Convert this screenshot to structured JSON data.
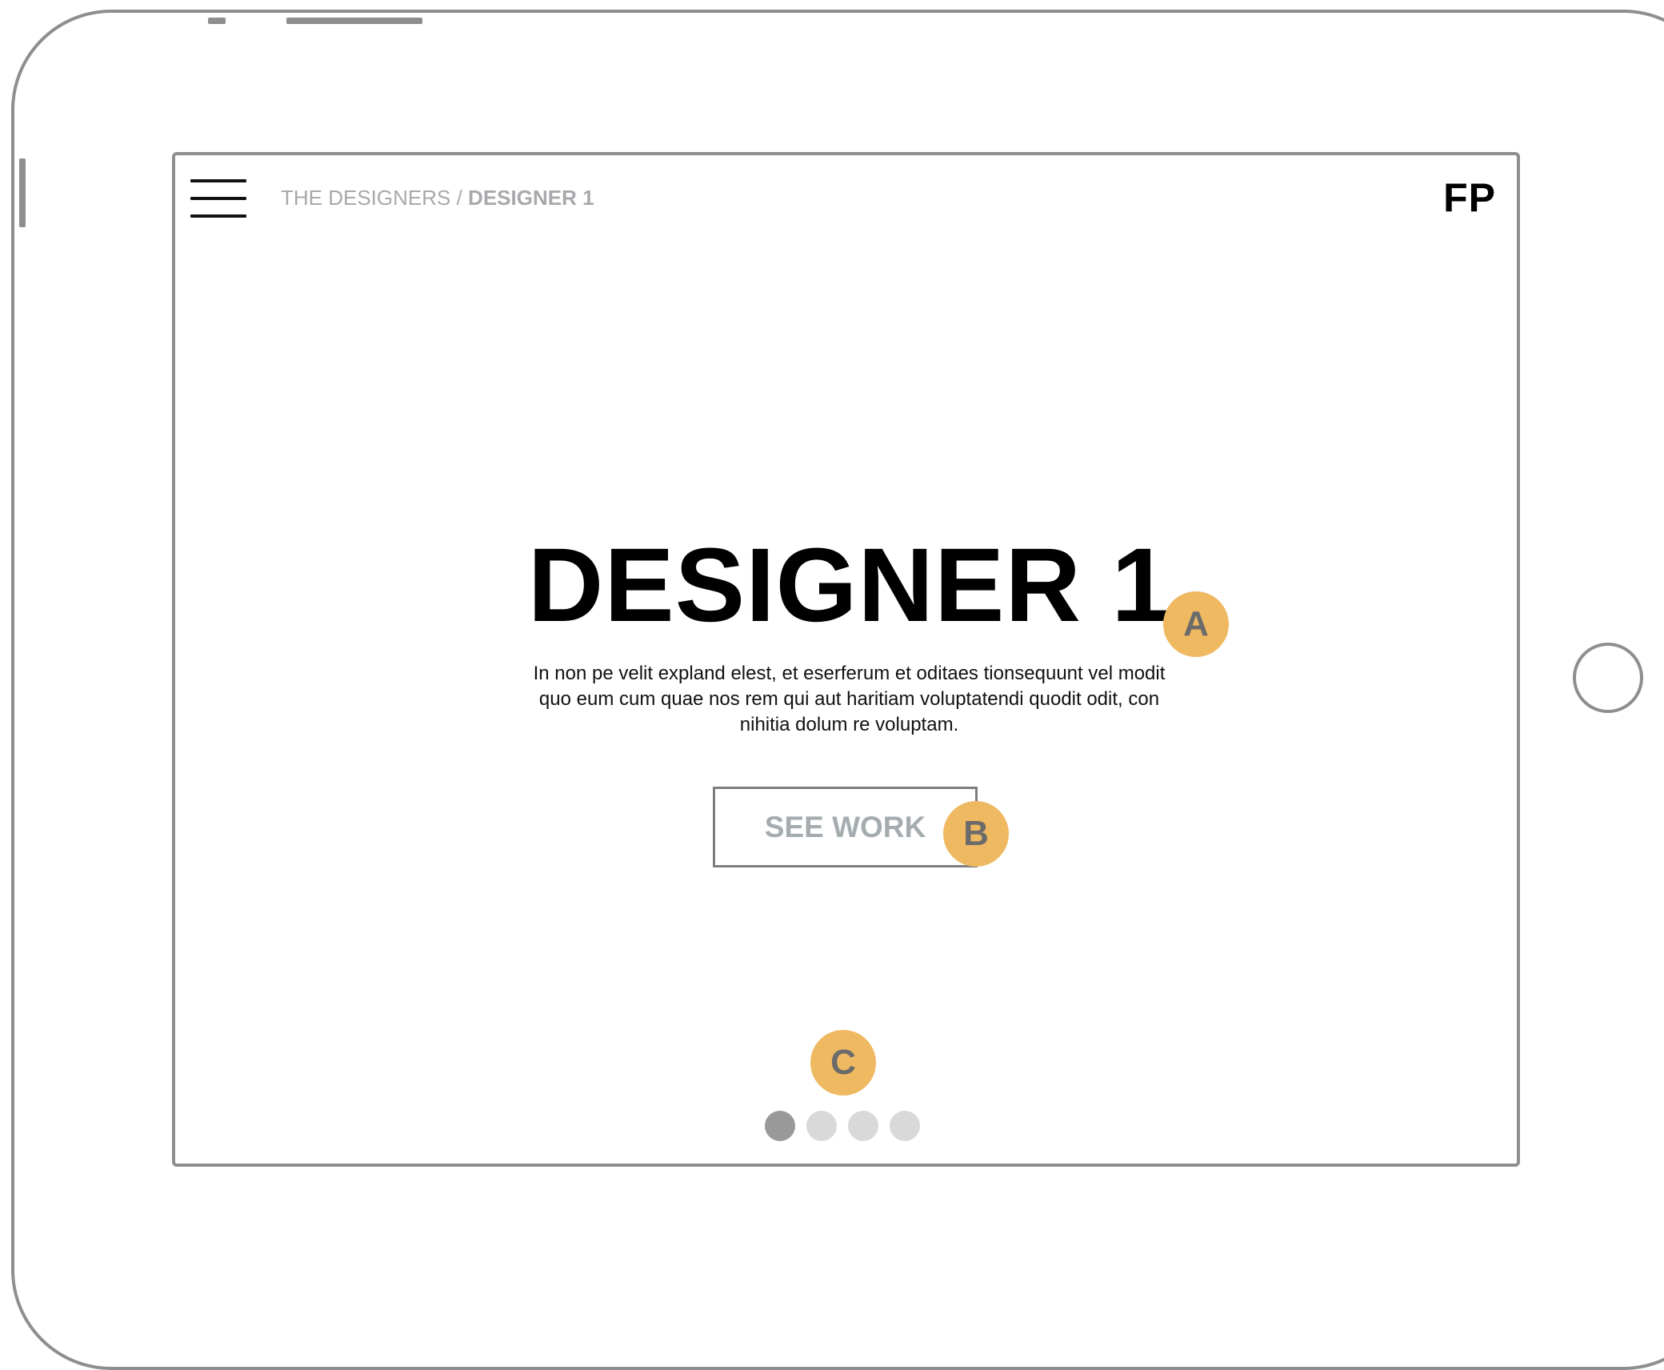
{
  "header": {
    "breadcrumb_parent": "THE DESIGNERS",
    "breadcrumb_separator": " / ",
    "breadcrumb_current": "DESIGNER 1",
    "logo": "FP"
  },
  "hero": {
    "title": "DESIGNER 1",
    "description": "In non pe velit expland elest, et eserferum et oditaes tionsequunt vel modit quo eum cum quae nos rem qui aut haritiam voluptatendi quodit odit, con nihitia dolum re voluptam.",
    "cta_label": "SEE WORK"
  },
  "pagination": {
    "total": 4,
    "active_index": 0
  },
  "annotations": {
    "a": "A",
    "b": "B",
    "c": "C"
  },
  "colors": {
    "frame": "#8e8e90",
    "marker": "#efb962",
    "marker_text": "#6b6b6b",
    "breadcrumb_text": "#a7a9ac",
    "button_text": "#a5acb0",
    "dot_active": "#999999",
    "dot_inactive": "#d9d9d9"
  },
  "icons": {
    "menu": "hamburger-menu-icon",
    "home": "home-button"
  }
}
